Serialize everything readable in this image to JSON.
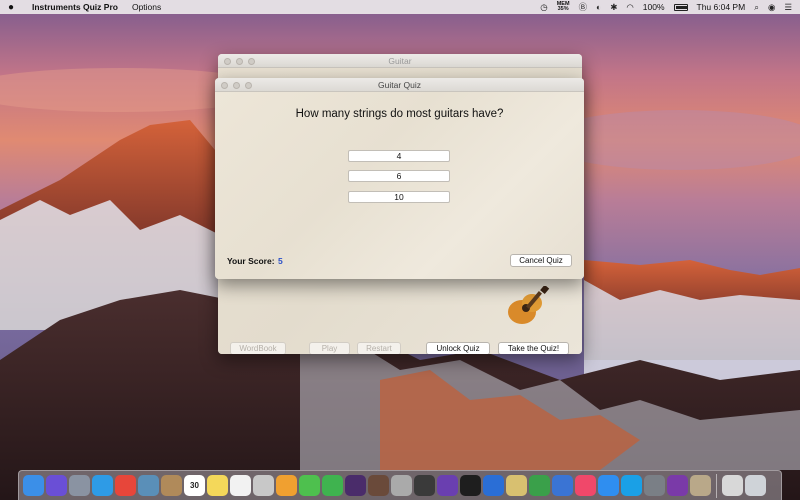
{
  "menubar": {
    "app_name": "Instruments Quiz Pro",
    "menus": [
      "Options"
    ],
    "mem_label": "MEM",
    "mem_value": "35%",
    "battery": "100%",
    "clock": "Thu 6:04 PM"
  },
  "background_window": {
    "title": "Guitar",
    "buttons": {
      "wordbook": "WordBook",
      "play": "Play",
      "restart": "Restart",
      "unlock_quiz": "Unlock Quiz",
      "take_quiz": "Take the Quiz!"
    }
  },
  "quiz_window": {
    "title": "Guitar Quiz",
    "question": "How many strings do most guitars have?",
    "answers": [
      "4",
      "6",
      "10"
    ],
    "score_label": "Your Score:",
    "score_value": "5",
    "cancel_label": "Cancel Quiz"
  },
  "dock": {
    "calendar_day": "30",
    "items": [
      {
        "name": "finder-icon",
        "color": "#3b8fe8"
      },
      {
        "name": "siri-icon",
        "color": "#6a4fd6"
      },
      {
        "name": "launchpad-icon",
        "color": "#8a93a2"
      },
      {
        "name": "safari-icon",
        "color": "#2e9be6"
      },
      {
        "name": "chrome-icon",
        "color": "#e7463a"
      },
      {
        "name": "preview-icon",
        "color": "#5a8fb8"
      },
      {
        "name": "contacts-icon",
        "color": "#b08a5a"
      },
      {
        "name": "calendar-icon",
        "color": "#ffffff"
      },
      {
        "name": "notes-icon",
        "color": "#f4d85a"
      },
      {
        "name": "reminders-icon",
        "color": "#f2f2f2"
      },
      {
        "name": "photos-app-icon",
        "color": "#c8c8c8"
      },
      {
        "name": "photos-icon",
        "color": "#f0a030"
      },
      {
        "name": "messages-icon",
        "color": "#4ec04e"
      },
      {
        "name": "facetime-icon",
        "color": "#3fb34f"
      },
      {
        "name": "itunes-icon",
        "color": "#4a2c6a"
      },
      {
        "name": "photobooth-icon",
        "color": "#6a4a3a"
      },
      {
        "name": "keychain-icon",
        "color": "#aaaaaa"
      },
      {
        "name": "finalcut-icon",
        "color": "#3a3a3a"
      },
      {
        "name": "imovie-icon",
        "color": "#6a3fb0"
      },
      {
        "name": "terminal-icon",
        "color": "#1e1e1e"
      },
      {
        "name": "xcode-icon",
        "color": "#2a6ed6"
      },
      {
        "name": "stickies-icon",
        "color": "#d8c070"
      },
      {
        "name": "numbers-icon",
        "color": "#3aa04a"
      },
      {
        "name": "keynote-icon",
        "color": "#3a74d4"
      },
      {
        "name": "music-icon",
        "color": "#f0486a"
      },
      {
        "name": "appstore-icon",
        "color": "#2f8ef0"
      },
      {
        "name": "skype-icon",
        "color": "#1aa0e6"
      },
      {
        "name": "system-preferences-icon",
        "color": "#7a7f86"
      },
      {
        "name": "onenote-icon",
        "color": "#7a3aa8"
      },
      {
        "name": "instruments-app-icon",
        "color": "#b9a889"
      }
    ],
    "after_separator": [
      {
        "name": "downloads-icon",
        "color": "#d8d8d8"
      },
      {
        "name": "trash-icon",
        "color": "#cfd3d8"
      }
    ]
  }
}
